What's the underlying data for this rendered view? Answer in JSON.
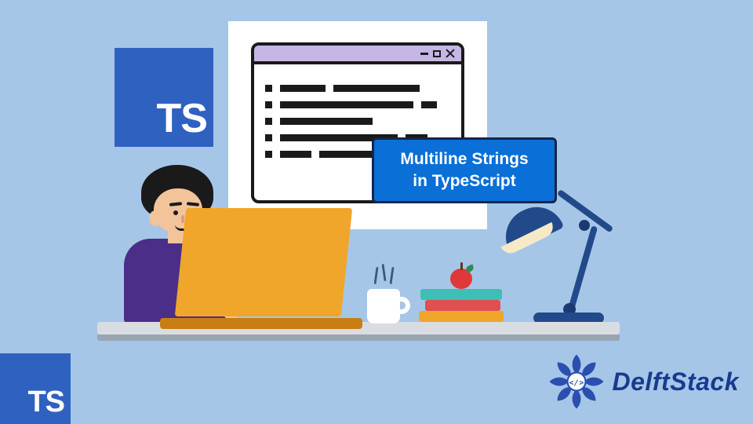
{
  "ts_label": "TS",
  "callout": {
    "line1": "Multiline Strings",
    "line2": "in TypeScript"
  },
  "watermark": {
    "brand": "DelftStack"
  }
}
